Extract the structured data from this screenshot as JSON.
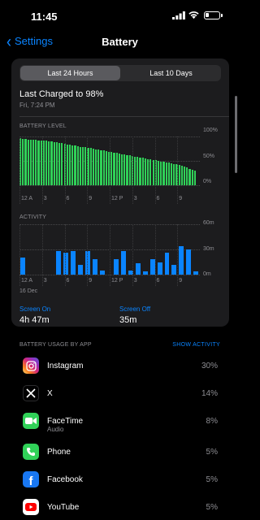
{
  "status": {
    "time": "11:45"
  },
  "nav": {
    "back_label": "Settings",
    "title": "Battery"
  },
  "segments": [
    {
      "label": "Last 24 Hours",
      "active": true
    },
    {
      "label": "Last 10 Days",
      "active": false
    }
  ],
  "charged": {
    "title": "Last Charged to 98%",
    "subtitle": "Fri, 7:24 PM"
  },
  "battery_level": {
    "label": "BATTERY LEVEL",
    "y_ticks": [
      "100%",
      "50%",
      "0%"
    ],
    "x_ticks": [
      "12 A",
      "3",
      "6",
      "9",
      "12 P",
      "3",
      "6",
      "9"
    ]
  },
  "activity": {
    "label": "ACTIVITY",
    "y_ticks": [
      "60m",
      "30m",
      "0m"
    ],
    "x_ticks": [
      "12 A",
      "3",
      "6",
      "9",
      "12 P",
      "3",
      "6",
      "9"
    ],
    "date_label": "16 Dec"
  },
  "screen_on": {
    "label": "Screen On",
    "value": "4h 47m"
  },
  "screen_off": {
    "label": "Screen Off",
    "value": "35m"
  },
  "usage": {
    "label": "BATTERY USAGE BY APP",
    "show_activity": "SHOW ACTIVITY",
    "apps": [
      {
        "name": "Instagram",
        "sub": "",
        "pct": "30%",
        "icon": "instagram-icon",
        "color": "#d62976"
      },
      {
        "name": "X",
        "sub": "",
        "pct": "14%",
        "icon": "x-icon",
        "color": "#000000"
      },
      {
        "name": "FaceTime",
        "sub": "Audio",
        "pct": "8%",
        "icon": "facetime-icon",
        "color": "#30d158"
      },
      {
        "name": "Phone",
        "sub": "",
        "pct": "5%",
        "icon": "phone-icon",
        "color": "#30d158"
      },
      {
        "name": "Facebook",
        "sub": "",
        "pct": "5%",
        "icon": "facebook-icon",
        "color": "#1877f2"
      },
      {
        "name": "YouTube",
        "sub": "",
        "pct": "5%",
        "icon": "youtube-icon",
        "color": "#ffffff"
      }
    ]
  },
  "colors": {
    "accent": "#0a84ff",
    "battery_green": "#30d158",
    "card_bg": "#1c1c1e"
  },
  "chart_data": [
    {
      "type": "bar",
      "title": "BATTERY LEVEL",
      "ylim": [
        0,
        100
      ],
      "values": [
        96,
        95,
        95,
        94,
        94,
        93,
        93,
        92,
        92,
        91,
        91,
        90,
        90,
        89,
        88,
        87,
        86,
        85,
        84,
        83,
        82,
        81,
        80,
        79,
        78,
        78,
        77,
        76,
        75,
        74,
        73,
        72,
        71,
        70,
        69,
        68,
        67,
        66,
        65,
        64,
        63,
        62,
        61,
        60,
        59,
        58,
        57,
        56,
        55,
        54,
        53,
        52,
        51,
        50,
        49,
        48,
        47,
        46,
        45,
        44,
        43,
        41,
        40,
        38,
        36,
        34,
        32,
        30
      ]
    },
    {
      "type": "bar",
      "title": "ACTIVITY",
      "ylim": [
        0,
        60
      ],
      "values": [
        20,
        0,
        0,
        0,
        0,
        0,
        0,
        0,
        0,
        0,
        0,
        0,
        0,
        0,
        0,
        0,
        0,
        0,
        0,
        0,
        0,
        0,
        0,
        0,
        0,
        0,
        0,
        0,
        0,
        0,
        0,
        0,
        0,
        0,
        0,
        0,
        0,
        0,
        0,
        0,
        0,
        0,
        0,
        0,
        0,
        0,
        0,
        0
      ],
      "series": [
        {
          "values": [
            20,
            0,
            0,
            0,
            0,
            28,
            26,
            28,
            12,
            28,
            18,
            5,
            0,
            18,
            28,
            5,
            14,
            4,
            18,
            15,
            26,
            12,
            34,
            30,
            4
          ]
        }
      ]
    }
  ]
}
